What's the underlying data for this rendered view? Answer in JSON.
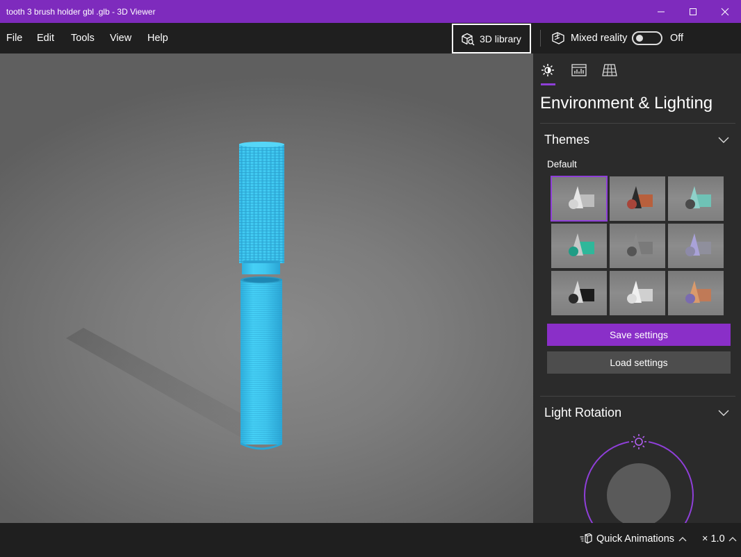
{
  "window": {
    "title": "tooth 3 brush holder gbl .glb - 3D Viewer",
    "controls": [
      "minimize",
      "maximize",
      "close"
    ]
  },
  "menu": {
    "items": [
      {
        "label": "File"
      },
      {
        "label": "Edit"
      },
      {
        "label": "Tools"
      },
      {
        "label": "View"
      },
      {
        "label": "Help"
      }
    ],
    "library_button": "3D library",
    "mixed_reality_label": "Mixed reality",
    "toggle_state": "Off"
  },
  "viewport": {
    "model_color": "#3fc8f2",
    "background_color": "#7d7d7d"
  },
  "panel": {
    "tabs": [
      {
        "icon": "sun-icon",
        "active": true
      },
      {
        "icon": "stats-icon",
        "active": false
      },
      {
        "icon": "grid-icon",
        "active": false
      }
    ],
    "title": "Environment & Lighting",
    "themes_title": "Themes",
    "themes_sub": "Default",
    "themes": [
      {
        "name": "default-white",
        "selected": true
      },
      {
        "name": "dark-orange",
        "selected": false
      },
      {
        "name": "teal",
        "selected": false
      },
      {
        "name": "green-teal",
        "selected": false
      },
      {
        "name": "dark-gray",
        "selected": false
      },
      {
        "name": "lavender",
        "selected": false
      },
      {
        "name": "black",
        "selected": false
      },
      {
        "name": "white",
        "selected": false
      },
      {
        "name": "sunset",
        "selected": false
      }
    ],
    "save_label": "Save settings",
    "load_label": "Load settings",
    "light_rotation_title": "Light Rotation",
    "accent_color": "#8a2fc8"
  },
  "status": {
    "quick_animations": "Quick Animations",
    "speed": "× 1.0"
  }
}
